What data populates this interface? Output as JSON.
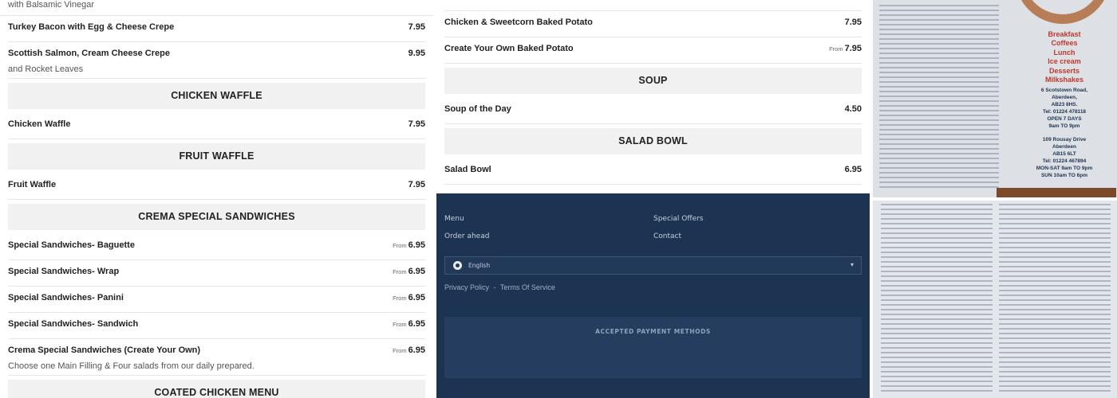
{
  "left_menu": {
    "top_fragment": "with Balsamic Vinegar",
    "rows": [
      {
        "kind": "item",
        "name": "Turkey Bacon with Egg & Cheese Crepe",
        "price": "7.95",
        "from": "",
        "desc": ""
      },
      {
        "kind": "item",
        "name": "Scottish Salmon, Cream Cheese Crepe",
        "price": "9.95",
        "from": "",
        "desc": "and Rocket Leaves"
      },
      {
        "kind": "header",
        "title": "CHICKEN WAFFLE"
      },
      {
        "kind": "item",
        "name": "Chicken Waffle",
        "price": "7.95",
        "from": "",
        "desc": ""
      },
      {
        "kind": "header",
        "title": "FRUIT WAFFLE"
      },
      {
        "kind": "item",
        "name": "Fruit Waffle",
        "price": "7.95",
        "from": "",
        "desc": ""
      },
      {
        "kind": "header",
        "title": "CREMA SPECIAL SANDWICHES"
      },
      {
        "kind": "item",
        "name": "Special Sandwiches- Baguette",
        "price": "6.95",
        "from": "From",
        "desc": ""
      },
      {
        "kind": "item",
        "name": "Special Sandwiches- Wrap",
        "price": "6.95",
        "from": "From",
        "desc": ""
      },
      {
        "kind": "item",
        "name": "Special Sandwiches- Panini",
        "price": "6.95",
        "from": "From",
        "desc": ""
      },
      {
        "kind": "item",
        "name": "Special Sandwiches- Sandwich",
        "price": "6.95",
        "from": "From",
        "desc": ""
      },
      {
        "kind": "item",
        "name": "Crema Special Sandwiches (Create Your Own)",
        "price": "6.95",
        "from": "From",
        "desc": "Choose one Main Filling & Four salads from our daily prepared."
      },
      {
        "kind": "header",
        "title": "COATED CHICKEN MENU"
      }
    ]
  },
  "mid_menu": {
    "rows": [
      {
        "kind": "item",
        "name": "Chicken & Sweetcorn Baked Potato",
        "price": "7.95",
        "from": "",
        "desc": ""
      },
      {
        "kind": "item",
        "name": "Create Your Own Baked Potato",
        "price": "7.95",
        "from": "From",
        "desc": ""
      },
      {
        "kind": "header",
        "title": "SOUP"
      },
      {
        "kind": "item",
        "name": "Soup of the Day",
        "price": "4.50",
        "from": "",
        "desc": ""
      },
      {
        "kind": "header",
        "title": "SALAD BOWL"
      },
      {
        "kind": "item",
        "name": "Salad Bowl",
        "price": "6.95",
        "from": "",
        "desc": ""
      }
    ]
  },
  "footer": {
    "links": {
      "menu": "Menu",
      "special_offers": "Special Offers",
      "order_ahead": "Order ahead",
      "contact": "Contact"
    },
    "language": "English",
    "privacy": "Privacy Policy",
    "separator": "-",
    "terms": "Terms Of Service",
    "payment_label": "ACCEPTED PAYMENT METHODS",
    "bg_color": "#1d3352"
  },
  "flyer_top": {
    "lines": [
      "Breakfast",
      "Coffees",
      "Lunch",
      "Ice cream",
      "Desserts",
      "Milkshakes"
    ],
    "address1": [
      "6 Scotstown Road,",
      "Aberdeen,",
      "AB23 8HS.",
      "Tel: 01224 478118",
      "OPEN 7 DAYS",
      "9am TO 9pm"
    ],
    "address2": [
      "109 Rousay Drive",
      "Aberdeen",
      "AB15 6LT",
      "Tel: 01224 467894",
      "MON-SAT 9am TO 9pm",
      "SUN 10am TO 6pm"
    ]
  }
}
